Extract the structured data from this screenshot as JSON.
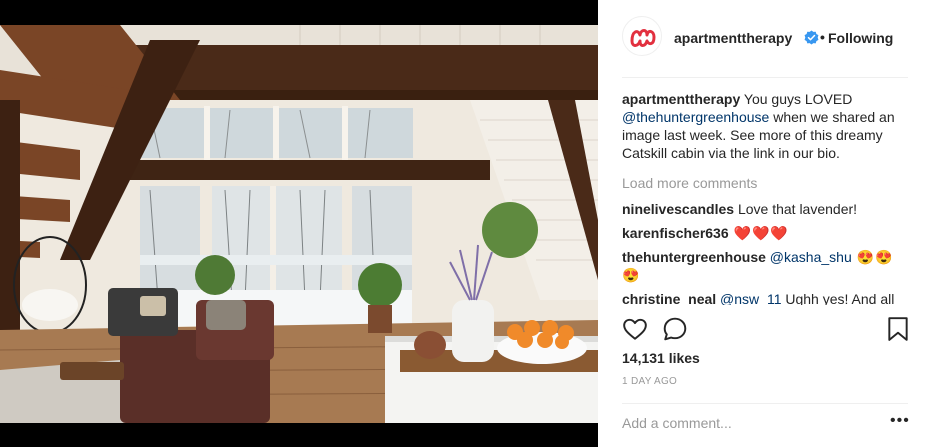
{
  "post": {
    "username": "apartmenttherapy",
    "dot": "•",
    "follow_status": "Following",
    "caption": {
      "author": "apartmenttherapy",
      "text_1": " You guys LOVED ",
      "mention": "@thehuntergreenhouse",
      "text_2": " when we shared an image last week. See more of this dreamy Catskill cabin via the link in our bio."
    },
    "load_more": "Load more comments",
    "comments": [
      {
        "user": "ninelivescandles",
        "text": " Love that lavender!"
      },
      {
        "user": "karenfischer636",
        "text": " ❤️❤️❤️"
      },
      {
        "user": "thehuntergreenhouse",
        "mention": "@kasha_shu",
        "text": " 😍😍😍"
      },
      {
        "user": "christine_neal",
        "mention": "@nsw_11",
        "text": " Ughh yes! And all"
      }
    ],
    "likes": "14,131 likes",
    "date": "1 DAY AGO",
    "add_comment_placeholder": "Add a comment...",
    "more_options": "•••"
  },
  "icons": {
    "avatar": "apartmenttherapy-logo",
    "verified": "verified-badge-icon",
    "like": "heart-outline-icon",
    "comment": "speech-bubble-icon",
    "save": "bookmark-icon"
  },
  "colors": {
    "brand_logo": "#e2303f",
    "verified": "#3897f0",
    "mention": "#003569",
    "muted": "#999999"
  }
}
